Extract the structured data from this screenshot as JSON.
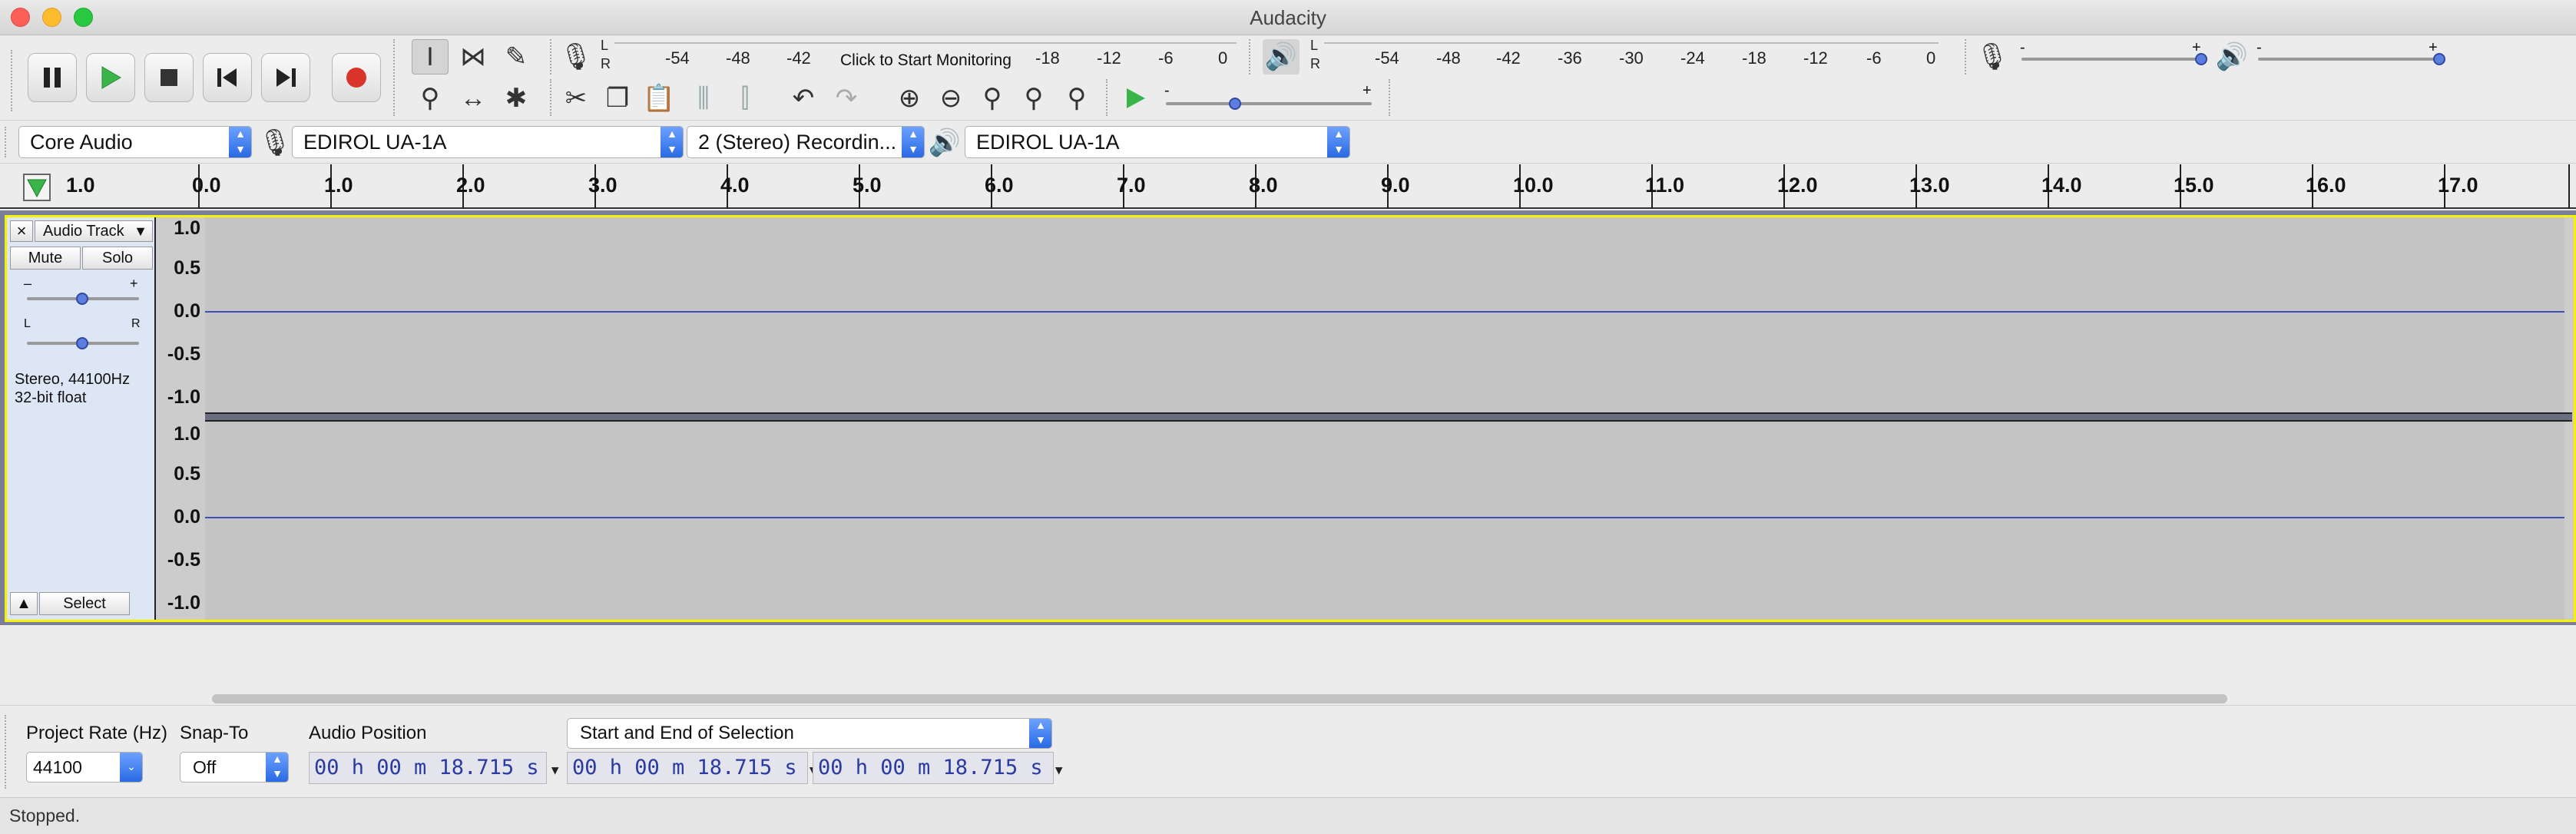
{
  "window": {
    "title": "Audacity"
  },
  "meters": {
    "record_scale": [
      "-54",
      "-48",
      "-42",
      "-18",
      "-12",
      "-6",
      "0"
    ],
    "record_prompt": "Click to Start Monitoring",
    "play_scale": [
      "-54",
      "-48",
      "-42",
      "-36",
      "-30",
      "-24",
      "-18",
      "-12",
      "-6",
      "0"
    ],
    "channels": [
      "L",
      "R"
    ]
  },
  "mixer": {
    "minus": "-",
    "plus": "+"
  },
  "devices": {
    "host": "Core Audio",
    "recording_device": "EDIROL UA-1A",
    "channels": "2 (Stereo) Recordin...",
    "playback_device": "EDIROL UA-1A"
  },
  "ruler": {
    "labels": [
      "1.0",
      "0.0",
      "1.0",
      "2.0",
      "3.0",
      "4.0",
      "5.0",
      "6.0",
      "7.0",
      "8.0",
      "9.0",
      "10.0",
      "11.0",
      "12.0",
      "13.0",
      "14.0",
      "15.0",
      "16.0",
      "17.0"
    ]
  },
  "track": {
    "close": "×",
    "name": "Audio Track",
    "mute": "Mute",
    "solo": "Solo",
    "gain_minus": "–",
    "gain_plus": "+",
    "pan_left": "L",
    "pan_right": "R",
    "info_line1": "Stereo, 44100Hz",
    "info_line2": "32-bit float",
    "select": "Select",
    "vscale": [
      "1.0",
      "0.5",
      "0.0",
      "-0.5",
      "-1.0"
    ]
  },
  "selection_bar": {
    "project_rate_label": "Project Rate (Hz)",
    "project_rate": "44100",
    "snap_label": "Snap-To",
    "snap_value": "Off",
    "audio_position_label": "Audio Position",
    "audio_position": "00 h 00 m 18.715 s",
    "selection_mode": "Start and End of Selection",
    "selection_start": "00 h 00 m 18.715 s",
    "selection_end": "00 h 00 m 18.715 s"
  },
  "status": {
    "text": "Stopped."
  },
  "colors": {
    "waveform_line": "#3f4fb5",
    "record": "#d9352c",
    "play": "#39b54a",
    "selected_track_border": "#f5f200"
  }
}
